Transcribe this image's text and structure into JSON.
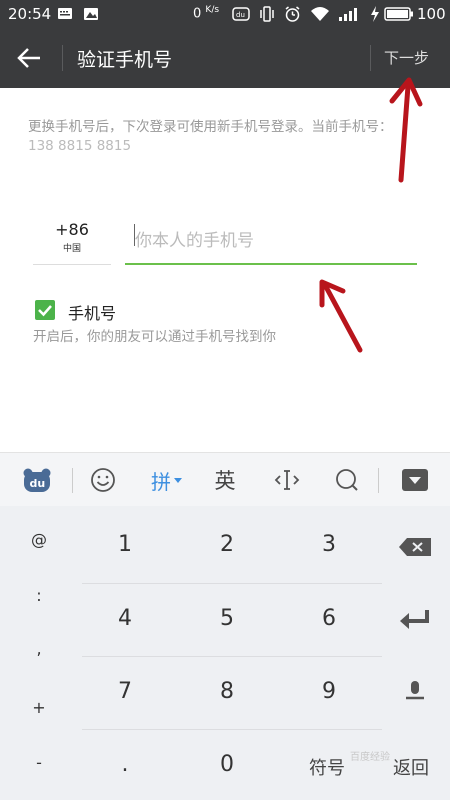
{
  "status_bar": {
    "time": "20:54",
    "speed_value": "0",
    "speed_unit": "K/s",
    "battery": "100",
    "icons": [
      "message-icon",
      "photo-icon",
      "baidu-icon",
      "vibrate-icon",
      "alarm-icon",
      "wifi-icon",
      "signal-icon",
      "charging-icon",
      "battery-icon"
    ]
  },
  "header": {
    "title": "验证手机号",
    "next_label": "下一步"
  },
  "body": {
    "description": "更换手机号后，下次登录可使用新手机号登录。当前手机号：",
    "current_phone_masked": "138 8815 8815",
    "country_code": "+86",
    "country_name": "中国",
    "phone_placeholder": "你本人的手机号",
    "phone_value": "",
    "checkbox_label": "手机号",
    "checkbox_checked": true,
    "checkbox_sub": "开启后，你的朋友可以通过手机号找到你"
  },
  "keyboard": {
    "toolbar": {
      "pinyin_label": "拼",
      "english_label": "英"
    },
    "symbols": [
      "@",
      ":",
      ",",
      "+",
      "-"
    ],
    "keys": [
      "1",
      "2",
      "3",
      "4",
      "5",
      "6",
      "7",
      "8",
      "9",
      ".",
      "0"
    ],
    "symbols_label": "符号",
    "return_label": "返回"
  },
  "colors": {
    "header_bg": "#3a3b3d",
    "accent_green": "#6bc04b",
    "checkbox_green": "#4cb34a",
    "pinyin_blue": "#3d8fe0",
    "arrow_red": "#b8151c"
  },
  "watermark": "百度经验"
}
